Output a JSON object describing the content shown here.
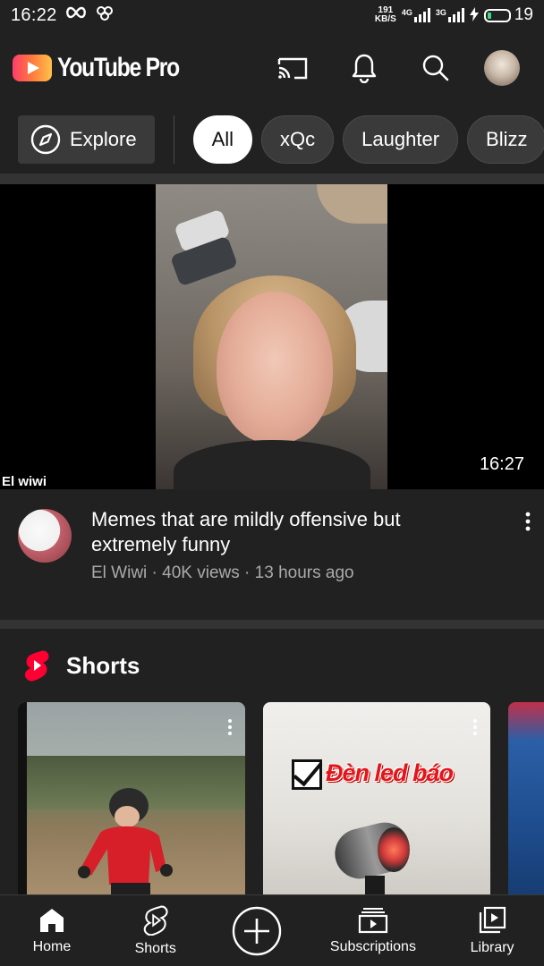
{
  "status_bar": {
    "time": "16:22",
    "speed_value": "191",
    "speed_unit": "KB/S",
    "net1": "4G",
    "net2": "3G",
    "battery": "19"
  },
  "app": {
    "title": "YouTube Pro"
  },
  "chips": {
    "explore_label": "Explore",
    "items": [
      "All",
      "xQc",
      "Laughter",
      "Blizz"
    ],
    "selected": "All"
  },
  "video": {
    "overlay_channel": "El wiwi",
    "duration": "16:27",
    "title": "Memes that are mildly offensive but extremely funny",
    "channel": "El Wiwi",
    "views": "40K views",
    "age": "13 hours ago",
    "meta_separator": " · "
  },
  "shorts": {
    "heading": "Shorts",
    "cards": [
      {
        "caption": ""
      },
      {
        "caption": "Đèn led báo"
      }
    ]
  },
  "bottom_nav": {
    "home": "Home",
    "shorts": "Shorts",
    "subscriptions": "Subscriptions",
    "library": "Library"
  },
  "colors": {
    "background": "#212121",
    "accent_red": "#ff0000",
    "chip_bg": "#3a3a3a",
    "secondary_text": "#aaaaaa"
  }
}
